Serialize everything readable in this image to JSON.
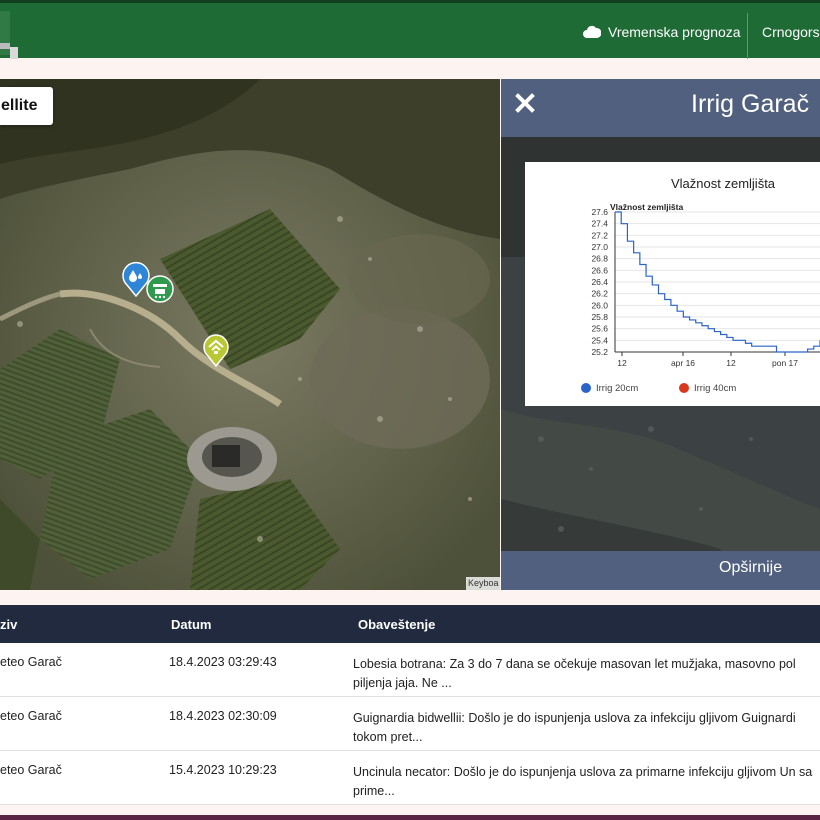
{
  "navbar": {
    "weather_label": "Vremenska prognoza",
    "region_label": "Crnogorsk",
    "weather_icon": "cloud-icon",
    "brand_color": "#1e6b35"
  },
  "map": {
    "layer_button_label": "ellite",
    "attribution": "Keyboa",
    "markers": [
      "water-drop-icon",
      "irrigation-icon",
      "weather-station-icon"
    ]
  },
  "panel": {
    "title": "Irrig Garač",
    "close_icon": "close-icon",
    "more_label": "Opširnije",
    "header_color": "#50607e"
  },
  "chart_data": {
    "type": "line",
    "title": "Vlažnost zemljišta",
    "ylabel": "Vlažnost zemljišta",
    "ylim": [
      25.2,
      27.6
    ],
    "y_ticks": [
      "27.6",
      "27.4",
      "27.2",
      "27.0",
      "26.8",
      "26.6",
      "26.4",
      "26.2",
      "26.0",
      "25.8",
      "25.6",
      "25.4",
      "25.2"
    ],
    "x_ticks": [
      "12",
      "apr 16",
      "12",
      "pon 17"
    ],
    "legend": [
      {
        "name": "Irrig 20cm",
        "color": "#2b63c6"
      },
      {
        "name": "Irrig 40cm",
        "color": "#d9381e"
      }
    ],
    "series": [
      {
        "name": "Irrig 20cm",
        "values": [
          27.6,
          27.4,
          27.1,
          26.9,
          26.7,
          26.5,
          26.35,
          26.2,
          26.1,
          26.0,
          25.9,
          25.8,
          25.75,
          25.7,
          25.65,
          25.6,
          25.55,
          25.5,
          25.45,
          25.4,
          25.4,
          25.35,
          25.3,
          25.3,
          25.3,
          25.3,
          25.2,
          25.2,
          25.2,
          25.2,
          25.2,
          25.25,
          25.3,
          25.4
        ]
      }
    ]
  },
  "table": {
    "headers": [
      "ziv",
      "Datum",
      "Obaveštenje"
    ],
    "rows": [
      {
        "name": "eteo Garač",
        "date": "18.4.2023 03:29:43",
        "message": "Lobesia botrana: Za 3 do 7 dana se očekuje masovan let mužjaka, masovno pol piljenja jaja. Ne ..."
      },
      {
        "name": "eteo Garač",
        "date": "18.4.2023 02:30:09",
        "message": "Guignardia bidwellii: Došlo je do ispunjenja uslova za infekciju gljivom Guignardi tokom pret..."
      },
      {
        "name": "eteo Garač",
        "date": "15.4.2023 10:29:23",
        "message": "Uncinula necator: Došlo je do ispunjenja uslova za primarne infekciju gljivom Un sa prime..."
      }
    ]
  }
}
